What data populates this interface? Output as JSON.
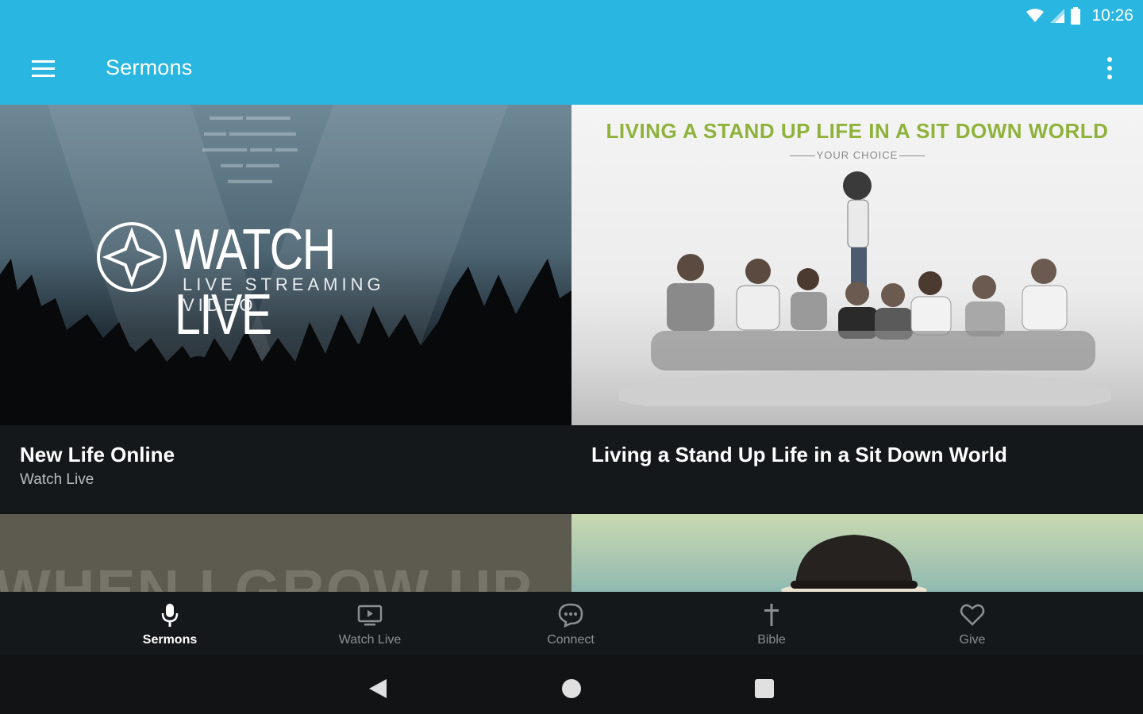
{
  "status_bar": {
    "time": "10:26"
  },
  "toolbar": {
    "title": "Sermons"
  },
  "cards": [
    {
      "title": "New Life Online",
      "subtitle": "Watch Live",
      "art": {
        "logo_title": "WATCH LIVE",
        "logo_subtitle": "LIVE STREAMING VIDEO"
      }
    },
    {
      "title": "Living a Stand Up Life in a Sit Down World",
      "subtitle": "",
      "art": {
        "headline": "LIVING A STAND UP LIFE IN A SIT DOWN WORLD",
        "tagline": "YOUR CHOICE"
      }
    },
    {
      "art": {
        "text": "WHEN I GROW UP"
      }
    },
    {
      "art": {}
    }
  ],
  "bottom_nav": [
    {
      "label": "Sermons",
      "icon": "microphone-icon",
      "active": true
    },
    {
      "label": "Watch Live",
      "icon": "tv-icon",
      "active": false
    },
    {
      "label": "Connect",
      "icon": "chat-bubble-icon",
      "active": false
    },
    {
      "label": "Bible",
      "icon": "cross-icon",
      "active": false
    },
    {
      "label": "Give",
      "icon": "heart-icon",
      "active": false
    }
  ],
  "colors": {
    "primary": "#29b6e0",
    "accent_green": "#8fb23b",
    "background": "#111315"
  }
}
